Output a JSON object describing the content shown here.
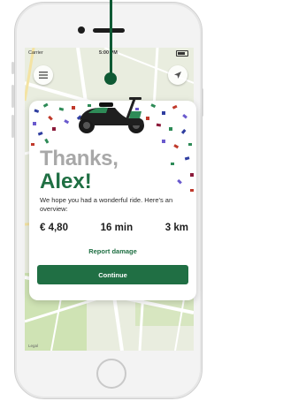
{
  "status_bar": {
    "carrier": "Carrier",
    "time": "5:00 PM"
  },
  "map": {
    "legal": "Legal"
  },
  "card": {
    "title_line1": "Thanks,",
    "title_line2": "Alex!",
    "description": "We hope you had a wonderful ride. Here's an overview:",
    "stats": {
      "price": "€ 4,80",
      "duration": "16 min",
      "distance": "3 km"
    },
    "report_link": "Report damage",
    "continue_label": "Continue"
  },
  "colors": {
    "brand_green": "#206f44",
    "title_gray": "#a8a8a8",
    "confetti": [
      "#2f3ea0",
      "#c0392b",
      "#2e8b57",
      "#6a5acd",
      "#8b1a3a"
    ]
  },
  "icons": {
    "menu": "menu-icon",
    "locate": "location-arrow-icon",
    "scooter": "scooter-icon"
  }
}
